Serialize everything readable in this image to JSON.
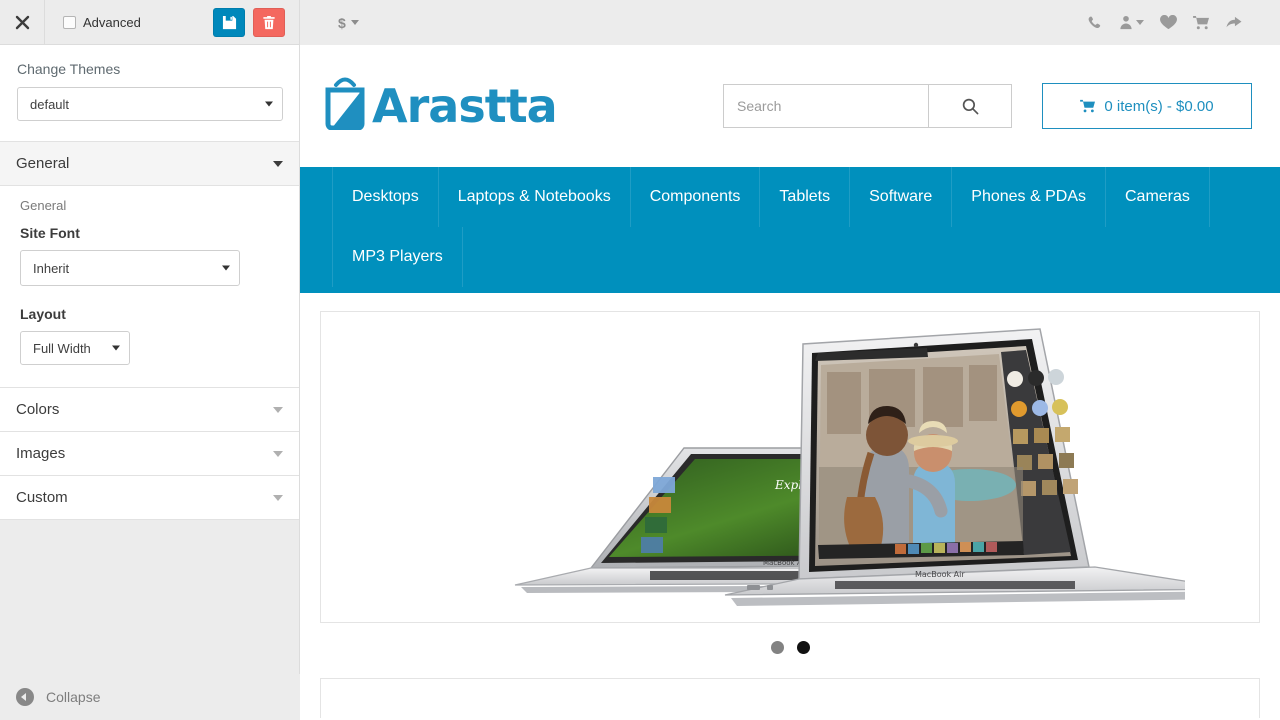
{
  "editor": {
    "close_icon": "close-icon",
    "advanced_label": "Advanced",
    "save_icon": "floppy-save-icon",
    "delete_icon": "trash-icon",
    "change_themes_label": "Change Themes",
    "theme_value": "default",
    "collapse_label": "Collapse",
    "accent_save_color": "#0088bb",
    "accent_delete_color": "#f4685f",
    "sections": [
      {
        "title": "General",
        "open": true,
        "sub_label": "General",
        "fields": [
          {
            "label": "Site Font",
            "value": "Inherit"
          },
          {
            "label": "Layout",
            "value": "Full Width"
          }
        ]
      },
      {
        "title": "Colors",
        "open": false
      },
      {
        "title": "Images",
        "open": false
      },
      {
        "title": "Custom",
        "open": false
      }
    ]
  },
  "store": {
    "topbar": {
      "currency_symbol": "$",
      "icons": [
        {
          "name": "phone-icon"
        },
        {
          "name": "user-account-icon"
        },
        {
          "name": "heart-wishlist-icon"
        },
        {
          "name": "shopping-cart-icon"
        },
        {
          "name": "checkout-arrow-icon"
        }
      ]
    },
    "logo_text": "Arastta",
    "logo_color": "#1f8fc0",
    "search": {
      "placeholder": "Search",
      "value": "",
      "button_icon": "search-icon"
    },
    "cart_button": {
      "label": "0 item(s) - $0.00",
      "icon": "shopping-cart-icon"
    },
    "nav_color": "#0090bd",
    "nav_row1": [
      "Desktops",
      "Laptops & Notebooks",
      "Components",
      "Tablets",
      "Software",
      "Phones & PDAs",
      "Cameras"
    ],
    "nav_row2": [
      "MP3 Players"
    ],
    "banner": {
      "alt": "MacBook Air laptops banner",
      "screen_caption": "Explore by land.",
      "model_label": "MacBook Air"
    },
    "carousel_dots": [
      {
        "state": "inactive"
      },
      {
        "state": "active"
      }
    ]
  }
}
